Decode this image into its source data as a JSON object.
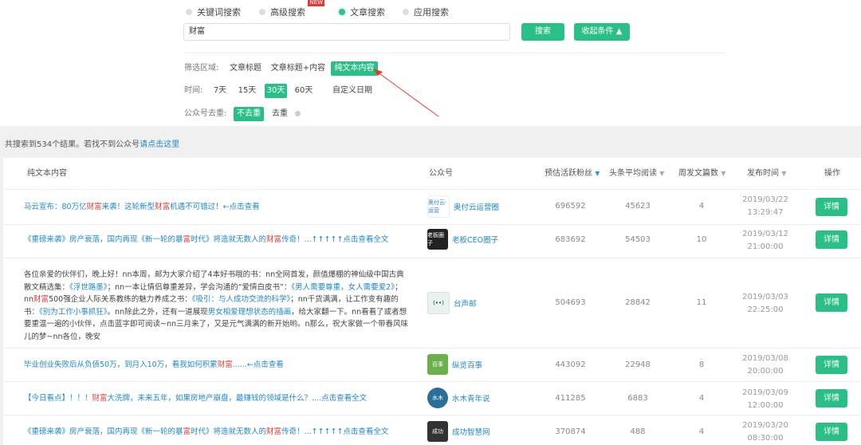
{
  "search_types": [
    {
      "label": "关键词搜索",
      "selected": false
    },
    {
      "label": "高级搜索",
      "selected": false,
      "badge": "NEW"
    },
    {
      "label": "文章搜索",
      "selected": true
    },
    {
      "label": "应用搜索",
      "selected": false
    }
  ],
  "search": {
    "value": "财富",
    "button": "搜索",
    "collapse": "收起条件 ▲"
  },
  "filters": {
    "area_label": "筛选区域:",
    "areas": [
      "文章标题",
      "文章标题+内容",
      "纯文本内容"
    ],
    "time_label": "时间:",
    "times": [
      "7天",
      "15天",
      "30天",
      "60天",
      "自定义日期"
    ],
    "dedup_label": "公众号去重:",
    "dedup": [
      "不去重",
      "去重"
    ]
  },
  "result_summary": {
    "text": "共搜索到534个结果。若找不到公众号",
    "link": "请点击这里"
  },
  "table": {
    "headers": [
      "纯文本内容",
      "公众号",
      "预估活跃粉丝",
      "头条平均阅读",
      "周发文篇数",
      "发布时间",
      "操作"
    ],
    "sort_icon": "▼",
    "detail_label": "详情",
    "rows": [
      {
        "title_pre": "马云宣布：80万亿",
        "hl1": "财富",
        "title_mid": "来袭！这轮新型",
        "hl2": "财富",
        "title_post": "机遇不可错过！←点击查看",
        "account": "奥付云运营圈",
        "avatar_text": "奥付云·运营",
        "avatar_color": "#ffffff",
        "fans": "696592",
        "reads": "45623",
        "weekly": "4",
        "date": "2019/03/22",
        "time": "13:29:47"
      },
      {
        "title_pre": "《重磅来袭》房产衰落，国内再现《新一轮的暴",
        "hl1": "富",
        "title_mid": "时代》将造就无数人的",
        "hl2": "财富",
        "title_post": "传奇！...↑↑↑↑↑点击查看全文",
        "account": "老板CEO圈子",
        "avatar_text": "老板圈子",
        "avatar_color": "#222222",
        "fans": "683692",
        "reads": "54503",
        "weekly": "10",
        "date": "2019/03/12",
        "time": "21:00:00"
      },
      {
        "para": {
          "p1": "各位亲爱的伙伴们，晚上好！nn本周，邮为大家介绍了4本好书哦的书：nn全网首发，颜值爆棚的神仙级中国古典散文精选集：",
          "l1": "《浮世路墨》",
          "p2": "；nn一本让情侣尊重差异，学会沟通的“爱情白皮书”：",
          "l2": "《男人需要尊重，女人需要爱2》",
          "p3": "；nn",
          "h1": "财富",
          "p4": "500强企业人际关系教练的魅力养成之书：",
          "l3": "《吸引：与人成功交流的科学》",
          "p5": "；nn千货满满，让工作变有趣的书：",
          "l4": "《别为工作小事抓狂》",
          "p6": "。nn除此之外，还有一道展现",
          "l5": "男女相爱理想状态的插画",
          "p7": "，给大家翻一下。nn看看了或者想要重温一遍的小伙伴，点击蓝字即可阅读~nn三月来了，又是元气满满的新开始哟。n那么，祝大家做一个带春风味儿的梦~nn各位，晚安"
        },
        "account": "台声邮",
        "avatar_text": "(••)",
        "avatar_color": "#e8f3ef",
        "fans": "504693",
        "reads": "28842",
        "weekly": "11",
        "date": "2019/03/03",
        "time": "22:25:00"
      },
      {
        "title_pre": "毕业创业失败后从负债50万，到月入10万，看我如何积累",
        "hl1": "财富",
        "title_mid": "......←点击查看",
        "hl2": "",
        "title_post": "",
        "account": "纵览百事",
        "avatar_text": "百事",
        "avatar_color": "#6ab04c",
        "fans": "443092",
        "reads": "22948",
        "weekly": "8",
        "date": "2019/03/08",
        "time": "20:00:00"
      },
      {
        "title_pre": "【今日看点】！！！",
        "hl1": "财富",
        "title_mid": "大洗牌，未来五年，如果房地产崩盘，最赚钱的领域是什么？....点击查看全文",
        "hl2": "",
        "title_post": "",
        "account": "水木青年说",
        "avatar_text": "水木",
        "avatar_color": "#2a6f97",
        "fans": "411285",
        "reads": "6883",
        "weekly": "4",
        "date": "2019/03/09",
        "time": "12:00:00"
      },
      {
        "title_pre": "《重磅来袭》房产衰落，国内再现《新一轮的暴",
        "hl1": "富",
        "title_mid": "时代》将造就无数人的",
        "hl2": "财富",
        "title_post": "传奇！...↑↑↑↑↑点击查看全文",
        "account": "成功智慧网",
        "avatar_text": "成功",
        "avatar_color": "#333333",
        "fans": "370874",
        "reads": "488",
        "weekly": "4",
        "date": "2019/03/20",
        "time": "08:30:00"
      }
    ]
  }
}
